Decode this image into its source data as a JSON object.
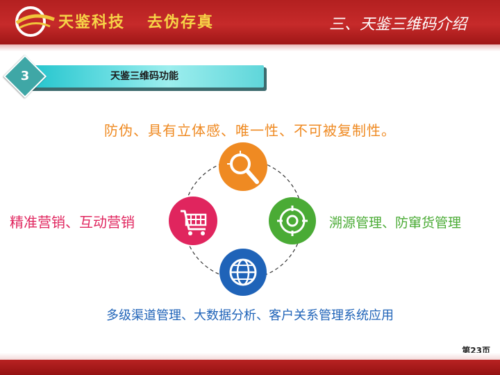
{
  "header": {
    "brand": "天鉴科技",
    "slogan": "去伪存真",
    "section_title": "三、天鉴三维码介绍"
  },
  "section": {
    "number": "3",
    "title": "天鉴三维码功能"
  },
  "labels": {
    "top": "防伪、具有立体感、唯一性、不可被复制性。",
    "left": "精准营销、互动营销",
    "right": "溯源管理、防窜货管理",
    "bottom": "多级渠道管理、大数据分析、客户关系管理系统应用"
  },
  "icons": [
    {
      "name": "magnifier-icon",
      "color": "#ef8a22"
    },
    {
      "name": "target-icon",
      "color": "#4aab35"
    },
    {
      "name": "globe-icon",
      "color": "#1f63b8"
    },
    {
      "name": "shopping-cart-icon",
      "color": "#e0255e"
    }
  ],
  "footer": {
    "page": "第23页"
  }
}
